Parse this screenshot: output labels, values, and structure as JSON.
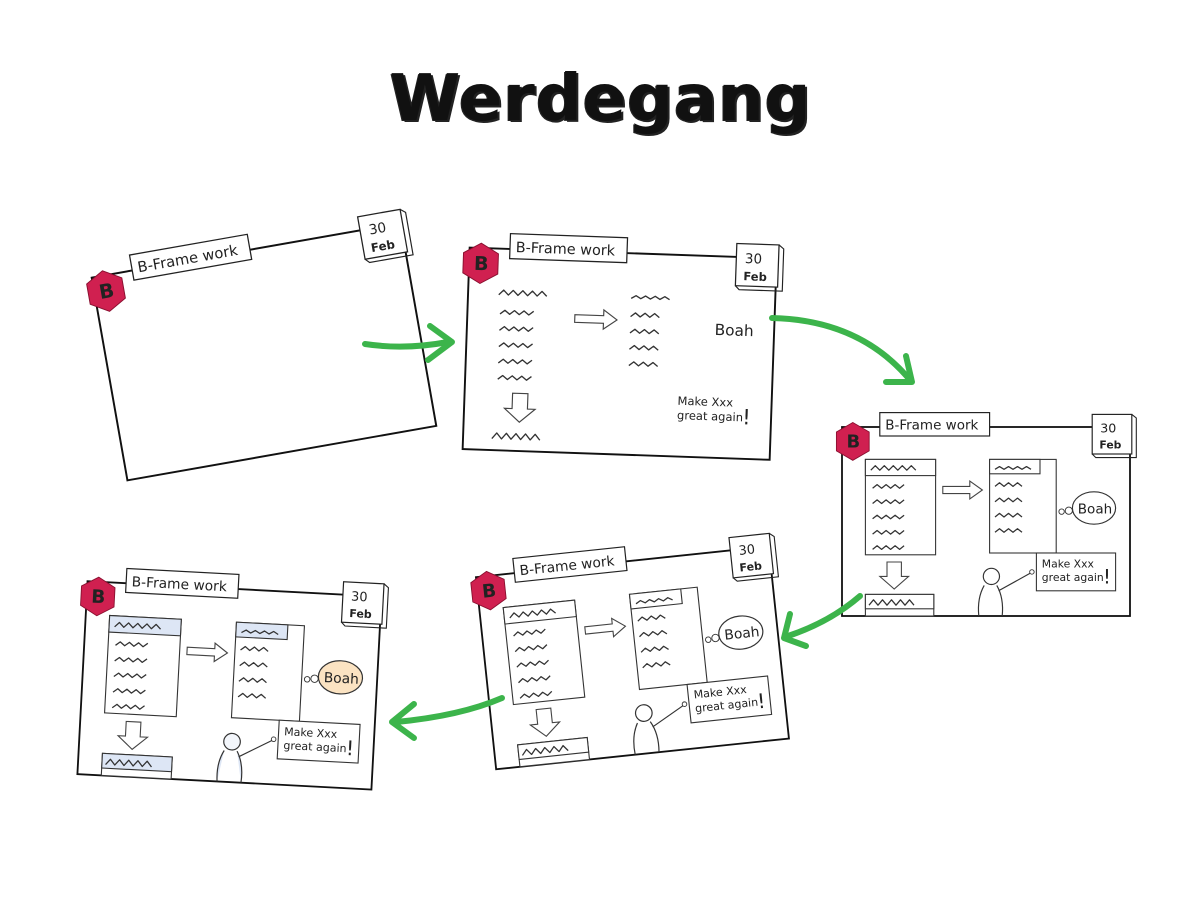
{
  "title": "Werdegang",
  "frame_label": "B-Frame work",
  "logo_letter": "B",
  "calendar": {
    "day": "30",
    "month": "Feb"
  },
  "notes": {
    "boah": "Boah",
    "make_line1": "Make Xxx",
    "make_line2": "great again",
    "exclaim": "!"
  },
  "colors": {
    "logo": "#d02050",
    "arrow": "#3cb44b",
    "highlight": "#dde6f5",
    "boah_fill": "#fbe3c2"
  }
}
